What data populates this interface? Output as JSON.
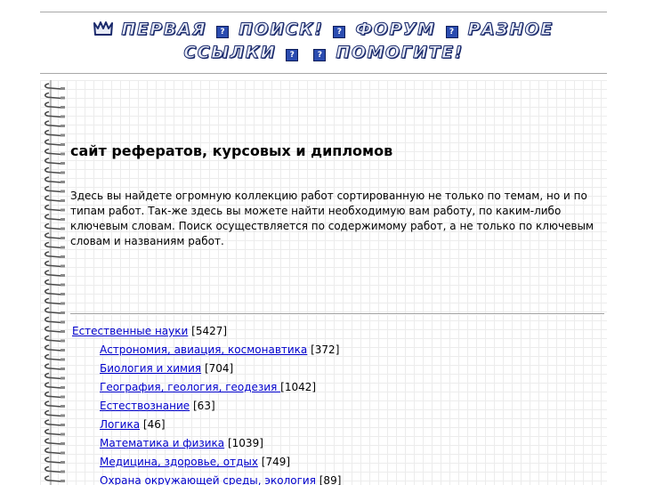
{
  "nav": {
    "row1": {
      "home": "ПЕРВАЯ",
      "search": "ПОИСК!",
      "forum": "ФОРУМ",
      "misc": "РАЗНОЕ"
    },
    "row2": {
      "links": "ССЫЛКИ",
      "help": "ПОМОГИТЕ!"
    },
    "separator_glyph": "?"
  },
  "heading": "сайт рефератов, курсовых и дипломов",
  "intro": "Здесь вы найдете огромную коллекцию работ сортированную не только по темам, но и по типам работ. Так-же здесь вы можете найти необходимую вам работу, по каким-либо ключевым словам. Поиск осуществляется по содержимому работ, а не только по ключевым словам и названиям работ.",
  "categories": [
    {
      "label": "Естественные науки",
      "count": "[5427]"
    },
    {
      "label": "Астрономия, авиация, космонавтика",
      "count": "[372]"
    },
    {
      "label": "Биология и химия",
      "count": "[704]"
    },
    {
      "label": "География, геология, геодезия ",
      "count": "[1042]"
    },
    {
      "label": "Естествознание",
      "count": "[63]"
    },
    {
      "label": "Логика",
      "count": "[46]"
    },
    {
      "label": "Математика и физика",
      "count": "[1039]"
    },
    {
      "label": "Медицина, здоровье, отдых",
      "count": "[749]"
    },
    {
      "label": "Охрана окружающей среды, экология",
      "count": "[89]"
    }
  ],
  "colors": {
    "nav_text": "#e8ebf6",
    "nav_outline": "#1a2a6c",
    "nav_box": "#2b4cb0",
    "link": "#0000cc",
    "divider": "#a8a8a8",
    "grid": "#ececec"
  }
}
